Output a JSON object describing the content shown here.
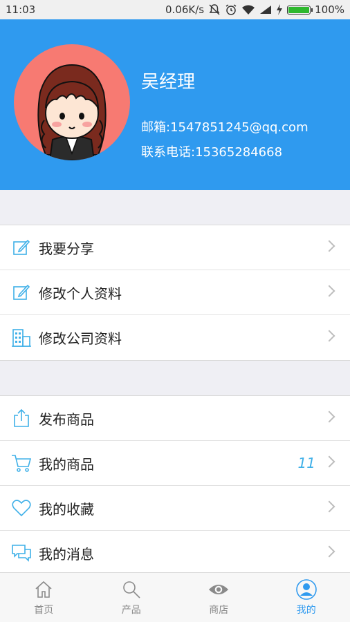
{
  "status_bar": {
    "time": "11:03",
    "network_speed": "0.06K/s",
    "battery_percent": "100%",
    "battery_level": 1.0,
    "icons": [
      "mute-icon",
      "alarm-icon",
      "wifi-icon",
      "signal-icon",
      "charging-icon",
      "battery-icon"
    ]
  },
  "profile": {
    "name": "吴经理",
    "email": "邮箱:1547851245@qq.com",
    "phone": "联系电话:15365284668",
    "avatar_bg": "#f77a72"
  },
  "colors": {
    "primary": "#2f9aef",
    "icon_blue": "#3fb0e8",
    "background": "#efeff4"
  },
  "menu_group1": [
    {
      "label": "我要分享",
      "icon": "edit-icon"
    },
    {
      "label": "修改个人资料",
      "icon": "edit-icon"
    },
    {
      "label": "修改公司资料",
      "icon": "building-icon"
    }
  ],
  "menu_group2": [
    {
      "label": "发布商品",
      "icon": "upload-icon"
    },
    {
      "label": "我的商品",
      "icon": "cart-icon",
      "count": "11"
    },
    {
      "label": "我的收藏",
      "icon": "heart-icon"
    },
    {
      "label": "我的消息",
      "icon": "message-icon"
    }
  ],
  "bottom_nav": [
    {
      "label": "首页",
      "icon": "home-icon",
      "active": false
    },
    {
      "label": "产品",
      "icon": "search-icon",
      "active": false
    },
    {
      "label": "商店",
      "icon": "eye-icon",
      "active": false
    },
    {
      "label": "我的",
      "icon": "profile-icon",
      "active": true
    }
  ]
}
